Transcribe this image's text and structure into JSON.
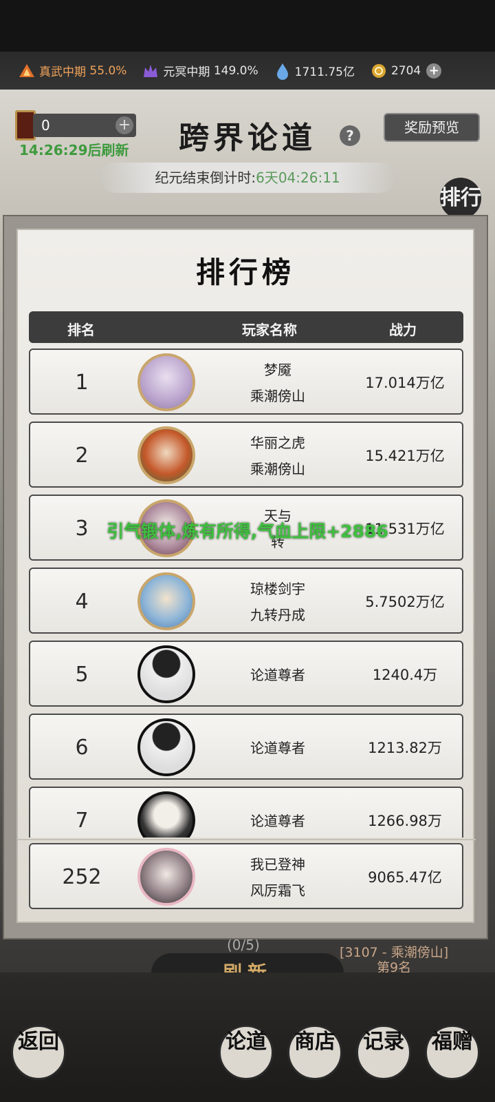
{
  "status": {
    "realm1": {
      "label": "真武中期",
      "value": "55.0%",
      "color": "#f0a35a"
    },
    "realm2": {
      "label": "元冥中期",
      "value": "149.0%"
    },
    "spirit": "1711.75亿",
    "gold": "2704"
  },
  "header": {
    "title": "跨界论道",
    "ticket_count": "0",
    "refresh_timer": "14:26:29后刷新",
    "reward_button": "奖励预览",
    "countdown_label": "纪元结束倒计时:",
    "countdown_value": "6天04:26:11",
    "side_rank_label": "排行"
  },
  "leaderboard": {
    "title": "排行榜",
    "columns": {
      "rank": "排名",
      "player": "玩家名称",
      "power": "战力"
    },
    "rows": [
      {
        "rank": "1",
        "name": "梦魇",
        "server": "乘潮傍山",
        "power": "17.014万亿"
      },
      {
        "rank": "2",
        "name": "华丽之虎",
        "server": "乘潮傍山",
        "power": "15.421万亿"
      },
      {
        "rank": "3",
        "name": "天与",
        "server": "转",
        "power": "11.531万亿"
      },
      {
        "rank": "4",
        "name": "琼楼剑宇",
        "server": "九转丹成",
        "power": "5.7502万亿"
      },
      {
        "rank": "5",
        "name": "论道尊者",
        "server": "",
        "power": "1240.4万"
      },
      {
        "rank": "6",
        "name": "论道尊者",
        "server": "",
        "power": "1213.82万"
      },
      {
        "rank": "7",
        "name": "论道尊者",
        "server": "",
        "power": "1266.98万"
      }
    ],
    "self": {
      "rank": "252",
      "name": "我已登神",
      "server": "风厉霜飞",
      "power": "9065.47亿"
    }
  },
  "toast": "引气锻体,炼有所得,气血上限+2886",
  "battle": {
    "progress": "(0/5)",
    "enemy_label": "[3107 - 乘潮傍山]",
    "enemy_rank": "第9名",
    "refresh_button": "刷新"
  },
  "nav": {
    "back": "返回",
    "debate": "论道",
    "shop": "商店",
    "record": "记录",
    "gift": "福赠"
  }
}
